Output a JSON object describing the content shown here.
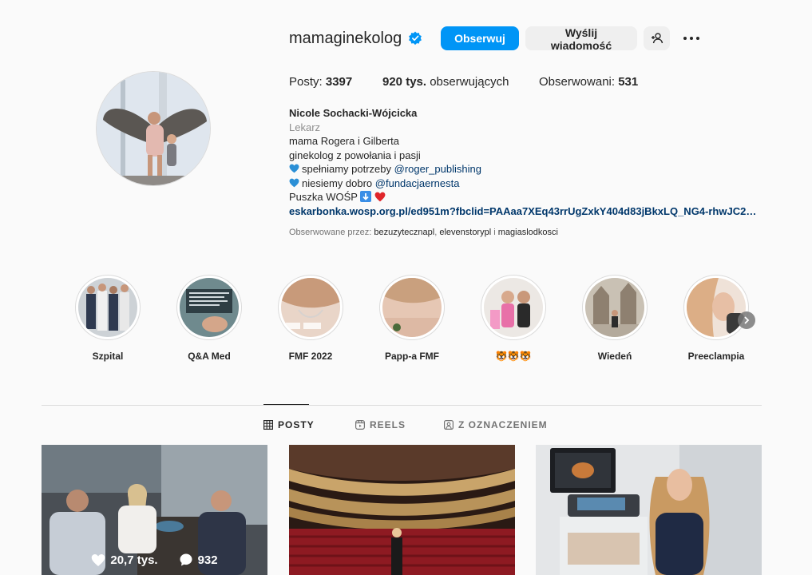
{
  "profile": {
    "username": "mamaginekolog",
    "follow_label": "Obserwuj",
    "message_label": "Wyślij wiadomość"
  },
  "stats": {
    "posts_label": "Posty:",
    "posts_value": "3397",
    "followers_value": "920 tys.",
    "followers_label": "obserwujących",
    "following_label": "Obserwowani:",
    "following_value": "531"
  },
  "bio": {
    "name": "Nicole Sochacki-Wójcicka",
    "category": "Lekarz",
    "line1": "mama Rogera i Gilberta",
    "line2": "ginekolog z powołania i pasji",
    "line3_text": "spełniamy potrzeby ",
    "line3_tag": "@roger_publishing",
    "line4_text": "niesiemy dobro ",
    "line4_tag": "@fundacjaernesta",
    "line5": "Puszka WOŚP",
    "link": "eskarbonka.wosp.org.pl/ed951m?fbclid=PAAaa7XEq43rrUgZxkY404d83jBkxLQ_NG4-rhwJC2_U..."
  },
  "followed_by": {
    "prefix": "Obserwowane przez:",
    "user1": "bezuzytecznapl",
    "sep1": ", ",
    "user2": "elevenstorypl",
    "sep2": " i ",
    "user3": "magiaslodkosci"
  },
  "highlights": [
    {
      "label": "Szpital"
    },
    {
      "label": "Q&A Med"
    },
    {
      "label": "FMF 2022"
    },
    {
      "label": "Papp-a FMF"
    },
    {
      "label": "🐯🐯🐯"
    },
    {
      "label": "Wiedeń"
    },
    {
      "label": "Preeclampia"
    }
  ],
  "tabs": {
    "posts": "POSTY",
    "reels": "REELS",
    "tagged": "Z OZNACZENIEM"
  },
  "grid": [
    {
      "likes": "20,7 tys.",
      "comments": "932"
    }
  ],
  "colors": {
    "accent": "#0095f6",
    "link": "#00376b",
    "verified": "#0095f6"
  }
}
